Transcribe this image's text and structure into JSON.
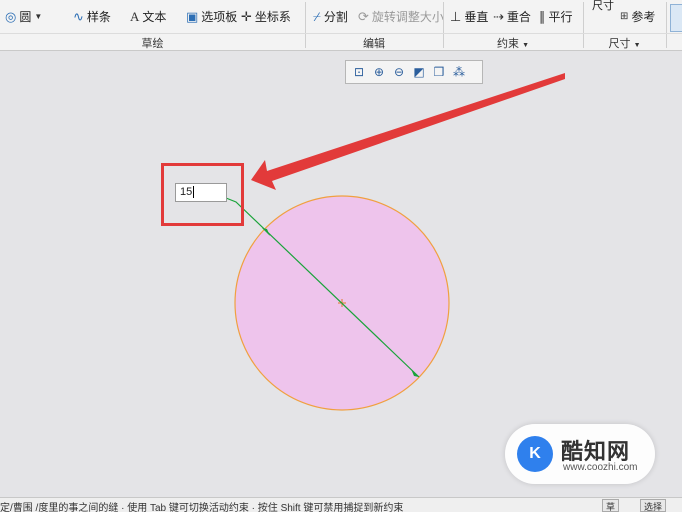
{
  "ribbon": {
    "sketch": {
      "title": "草绘",
      "circle": "圆",
      "spline": "样条",
      "text": "文本",
      "palette": "选项板",
      "coordsys": "坐标系"
    },
    "edit": {
      "title": "编辑",
      "divide": "分割",
      "rotate_resize": "旋转调整大小"
    },
    "constrain": {
      "title": "约束",
      "vertical": "垂直",
      "coincident": "重合",
      "parallel": "平行"
    },
    "dimension": {
      "title": "尺寸",
      "top_label": "尺寸",
      "reference": "参考"
    }
  },
  "canvas": {
    "dimension_value": "15",
    "circle_fill": "#eec4ec",
    "circle_stroke": "#f0a040",
    "dim_line_color": "#1aa33a",
    "annotation_color": "#e23a3a"
  },
  "watermark": {
    "logo_text": "K",
    "name": "酷知网",
    "url": "www.coozhi.com"
  },
  "status": {
    "message": "定/曹围 /度里的事之间的缝 · 使用 Tab 键可切换活动约束 · 按住 Shift 键可禁用捕捉到新约束",
    "btn1": "草",
    "btn2": "选择"
  }
}
